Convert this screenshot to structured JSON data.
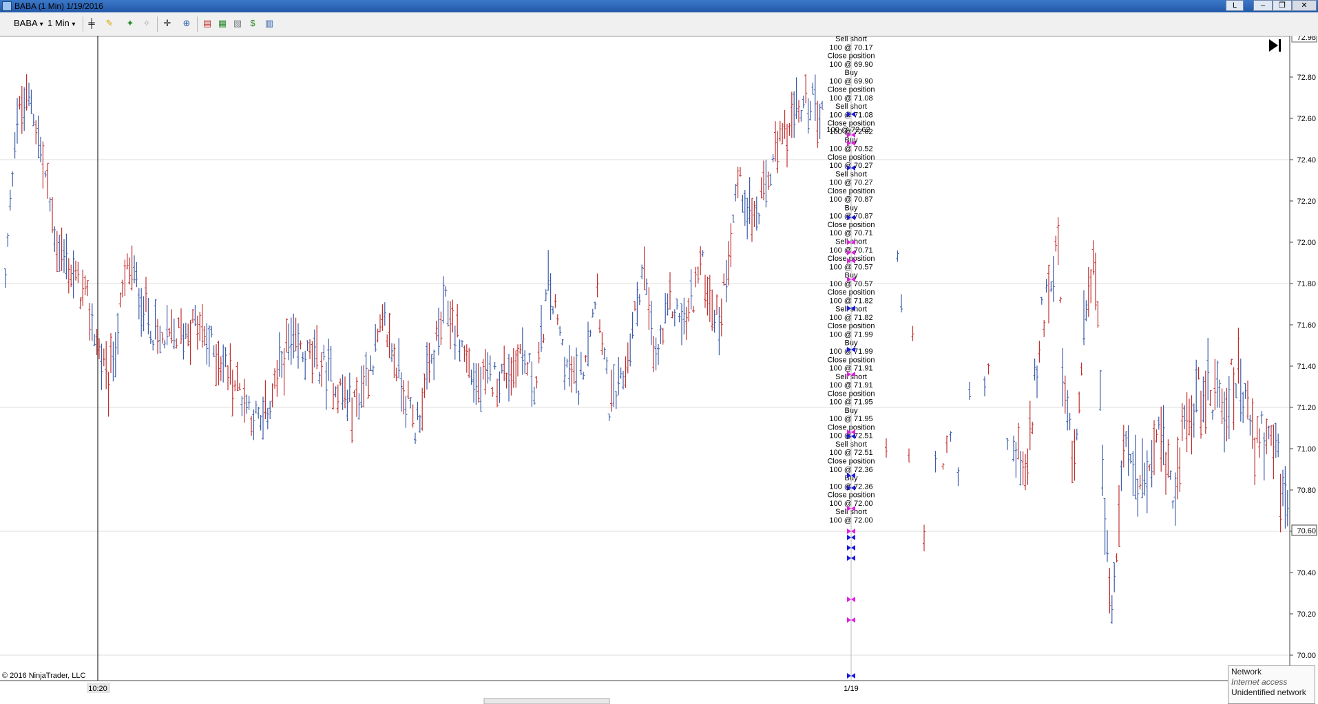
{
  "window": {
    "title": "BABA (1 Min)  1/19/2016",
    "tray_btn": "L",
    "minimize": "–",
    "restore": "❐",
    "close": "✕"
  },
  "toolbar": {
    "instrument": "BABA",
    "interval": "1 Min",
    "dropdown_arrow": "▾",
    "icons": {
      "bar_type": "bar-type-icon",
      "pencil": "pencil-icon",
      "marker": "marker-icon",
      "eraser": "eraser-icon",
      "crosshair": "crosshair-icon",
      "zoom": "zoom-icon",
      "indicators": "indicators-icon",
      "strategies": "strategies-icon",
      "template": "template-icon",
      "money": "money-icon",
      "panel": "panel-icon"
    }
  },
  "copyright": "© 2016 NinjaTrader, LLC",
  "play_icon": "go-to-end-icon",
  "popup": {
    "title": "Network",
    "subtitle": "Internet access",
    "status": "Unidentified network"
  },
  "colors": {
    "up": "#3c5ca8",
    "down": "#c03030",
    "buy": "#1a1ae0",
    "sell": "#e020e0"
  },
  "chart_data": {
    "type": "bar",
    "title": "BABA (1 Min)",
    "ylim": [
      70.0,
      72.98
    ],
    "y_ticks": [
      "72.80",
      "72.60",
      "72.40",
      "72.20",
      "72.00",
      "71.80",
      "71.60",
      "71.40",
      "71.20",
      "71.00",
      "70.80",
      "70.60",
      "70.40",
      "70.20",
      "70.00"
    ],
    "y_top_label": "72.98",
    "last_price": "70.60",
    "x_labels": [
      "10:20",
      "1/19"
    ],
    "grid": true,
    "session1_points": [
      [
        0,
        71.8
      ],
      [
        0.02,
        72.6
      ],
      [
        0.05,
        72.7
      ],
      [
        0.1,
        72.0
      ],
      [
        0.16,
        71.7
      ],
      [
        0.2,
        71.3
      ],
      [
        0.24,
        71.9
      ],
      [
        0.3,
        71.5
      ],
      [
        0.37,
        71.6
      ],
      [
        0.43,
        71.4
      ],
      [
        0.5,
        71.1
      ],
      [
        0.55,
        71.5
      ],
      [
        0.62,
        71.4
      ],
      [
        0.68,
        71.2
      ],
      [
        0.74,
        71.6
      ],
      [
        0.8,
        71.1
      ],
      [
        0.86,
        71.7
      ],
      [
        0.92,
        71.3
      ],
      [
        1.0,
        71.4
      ]
    ],
    "session2_points": [
      [
        0,
        71.5
      ],
      [
        0.06,
        71.3
      ],
      [
        0.1,
        71.8
      ],
      [
        0.16,
        71.4
      ],
      [
        0.2,
        71.3
      ],
      [
        0.26,
        71.8
      ],
      [
        0.3,
        71.2
      ],
      [
        0.34,
        71.3
      ],
      [
        0.38,
        71.6
      ],
      [
        0.41,
        71.9
      ],
      [
        0.45,
        71.4
      ],
      [
        0.5,
        71.7
      ],
      [
        0.55,
        71.6
      ],
      [
        0.6,
        71.9
      ],
      [
        0.66,
        71.6
      ],
      [
        0.72,
        72.3
      ],
      [
        0.78,
        72.1
      ],
      [
        0.84,
        72.4
      ],
      [
        0.9,
        72.6
      ],
      [
        0.96,
        72.7
      ],
      [
        1.0,
        72.6
      ]
    ],
    "session3_points": [
      [
        0,
        71.0
      ],
      [
        0.05,
        70.9
      ],
      [
        0.1,
        71.6
      ],
      [
        0.14,
        71.9
      ],
      [
        0.16,
        72.0
      ],
      [
        0.18,
        71.3
      ],
      [
        0.22,
        70.9
      ],
      [
        0.26,
        71.7
      ],
      [
        0.3,
        71.9
      ],
      [
        0.33,
        70.6
      ],
      [
        0.36,
        70.3
      ],
      [
        0.4,
        71.0
      ],
      [
        0.46,
        70.8
      ],
      [
        0.52,
        71.1
      ],
      [
        0.58,
        70.8
      ],
      [
        0.64,
        71.2
      ],
      [
        0.7,
        71.3
      ],
      [
        0.76,
        71.2
      ],
      [
        0.82,
        71.4
      ],
      [
        0.88,
        71.0
      ],
      [
        0.94,
        71.1
      ],
      [
        0.98,
        70.8
      ],
      [
        1.0,
        70.6
      ]
    ],
    "trade_labels": [
      "Sell short",
      "100 @ 70.17",
      "Close position",
      "100 @ 69.90",
      "Buy",
      "100 @ 69.90",
      "Close position",
      "100 @ 71.08",
      "Sell short",
      "100 @ 71.08",
      "Close position",
      "100 @ 72.62",
      "Buy",
      "100 @ 70.52",
      "Close position",
      "100 @ 70.27",
      "Sell short",
      "100 @ 70.27",
      "Close position",
      "100 @ 70.87",
      "Buy",
      "100 @ 70.87",
      "Close position",
      "100 @ 70.71",
      "Sell short",
      "100 @ 70.71",
      "Close position",
      "100 @ 70.57",
      "Buy",
      "100 @ 70.57",
      "Close position",
      "100 @ 71.82",
      "Sell short",
      "100 @ 71.82",
      "Close position",
      "100 @ 71.99",
      "Buy",
      "100 @ 71.99",
      "Close position",
      "100 @ 71.91",
      "Sell short",
      "100 @ 71.91",
      "Close position",
      "100 @ 71.95",
      "Buy",
      "100 @ 71.95",
      "Close position",
      "100 @ 72.51",
      "Sell short",
      "100 @ 72.51",
      "Close position",
      "100 @ 72.36",
      "Buy",
      "100 @ 72.36",
      "Close position",
      "100 @ 72.00",
      "Sell short",
      "100 @ 72.00"
    ],
    "overlap_label": "100 @ 72.62",
    "markers": [
      {
        "price": 72.62,
        "side": "buy"
      },
      {
        "price": 72.52,
        "side": "sell"
      },
      {
        "price": 72.48,
        "side": "sell"
      },
      {
        "price": 72.36,
        "side": "buy"
      },
      {
        "price": 72.12,
        "side": "buy"
      },
      {
        "price": 72.0,
        "side": "sell"
      },
      {
        "price": 71.95,
        "side": "sell"
      },
      {
        "price": 71.91,
        "side": "sell"
      },
      {
        "price": 71.82,
        "side": "sell"
      },
      {
        "price": 71.68,
        "side": "buy"
      },
      {
        "price": 71.48,
        "side": "buy"
      },
      {
        "price": 71.36,
        "side": "sell"
      },
      {
        "price": 71.08,
        "side": "sell"
      },
      {
        "price": 71.06,
        "side": "buy"
      },
      {
        "price": 70.87,
        "side": "buy"
      },
      {
        "price": 70.81,
        "side": "buy"
      },
      {
        "price": 70.71,
        "side": "sell"
      },
      {
        "price": 70.6,
        "side": "sell"
      },
      {
        "price": 70.57,
        "side": "buy"
      },
      {
        "price": 70.52,
        "side": "buy"
      },
      {
        "price": 70.47,
        "side": "buy"
      },
      {
        "price": 70.27,
        "side": "sell"
      },
      {
        "price": 70.17,
        "side": "sell"
      },
      {
        "price": 69.9,
        "side": "buy"
      }
    ]
  }
}
